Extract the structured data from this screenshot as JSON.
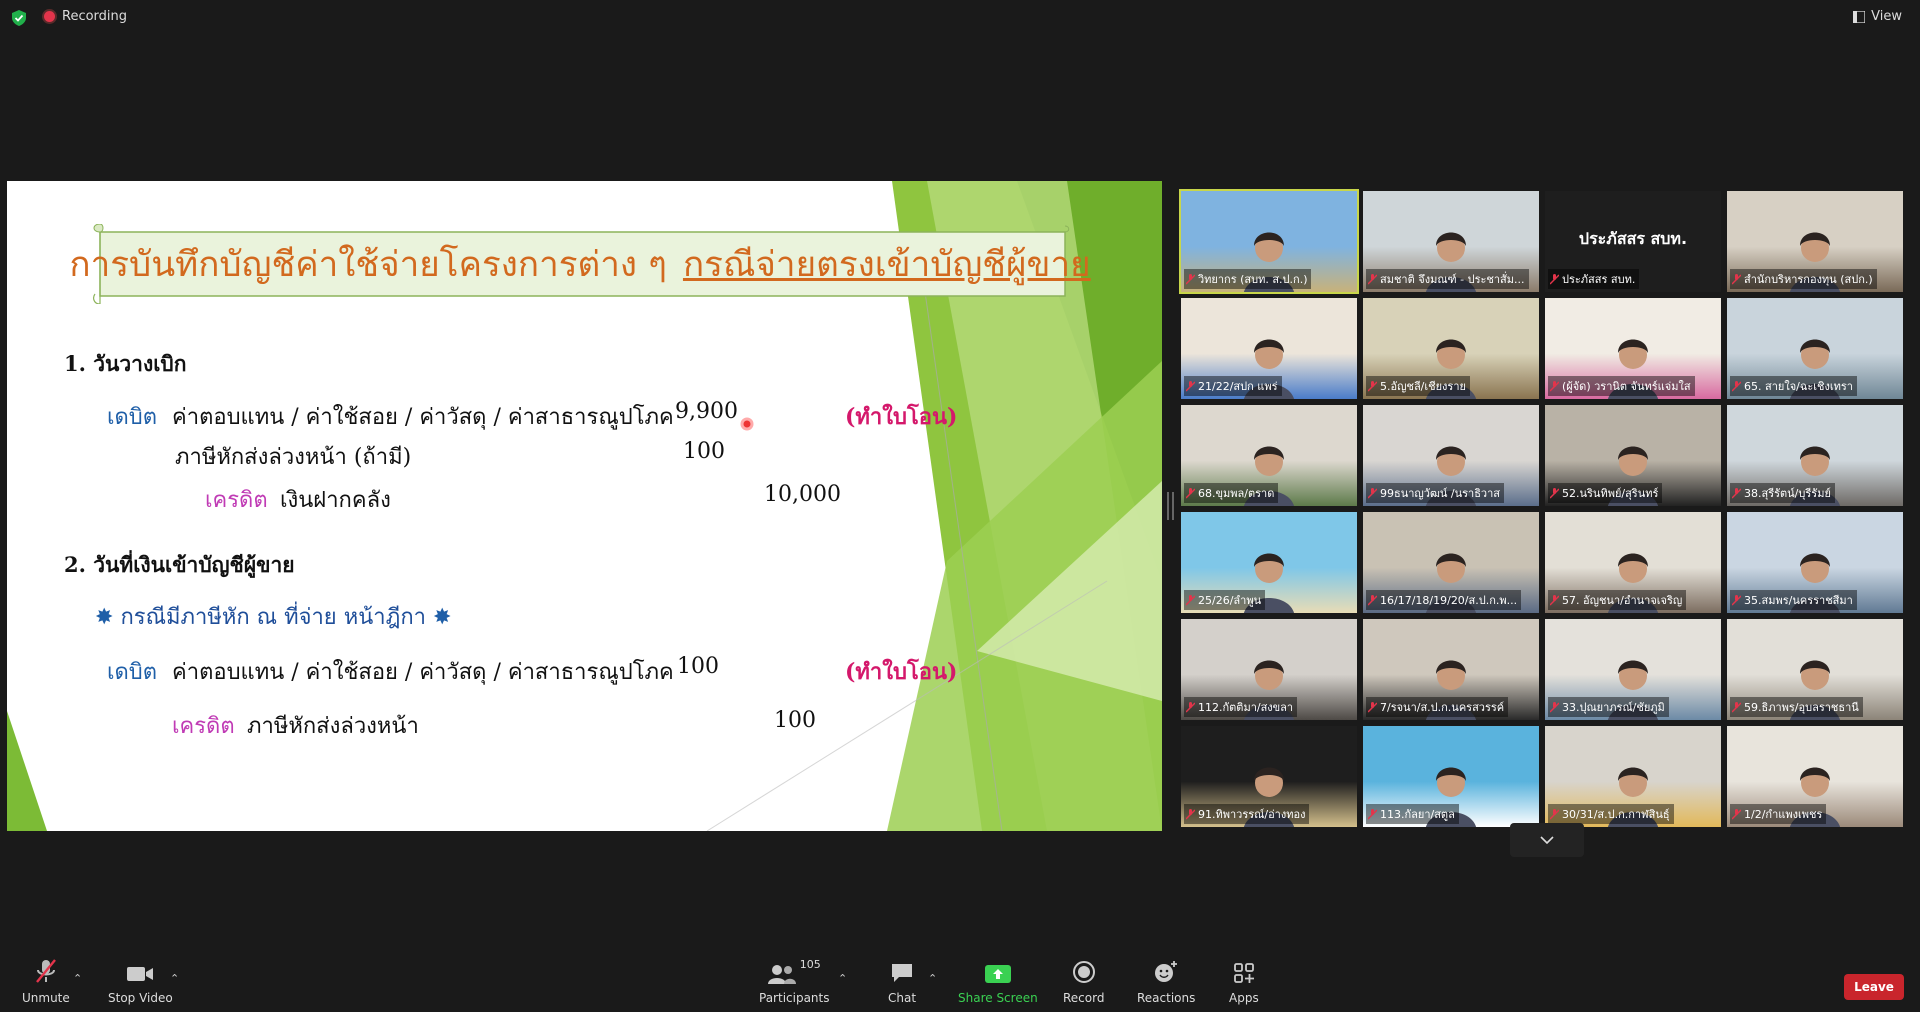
{
  "top": {
    "recording": "Recording",
    "view": "View"
  },
  "slide": {
    "title_part1": "การบันทึกบัญชีค่าใช้จ่ายโครงการต่าง ๆ",
    "title_part2": "กรณีจ่ายตรงเข้าบัญชีผู้ขาย",
    "s1_heading": "1. วันวางเบิก",
    "s1_debit_label": "เดบิต",
    "s1_debit_item": "ค่าตอบแทน / ค่าใช้สอย / ค่าวัสดุ / ค่าสาธารณูปโภค",
    "s1_debit_amount": "9,900",
    "s1_note": "(ทำใบโอน)",
    "s1_tax_item": "ภาษีหักส่งล่วงหน้า (ถ้ามี)",
    "s1_tax_amount": "100",
    "s1_credit_label": "เครดิต",
    "s1_credit_item": "เงินฝากคลัง",
    "s1_credit_amount": "10,000",
    "s2_heading": "2. วันที่เงินเข้าบัญชีผู้ขาย",
    "s2_subcase": "กรณีมีภาษีหัก ณ ที่จ่าย หน้าฎีกา",
    "s2_debit_label": "เดบิต",
    "s2_debit_item": "ค่าตอบแทน / ค่าใช้สอย / ค่าวัสดุ / ค่าสาธารณูปโภค",
    "s2_debit_amount": "100",
    "s2_note": "(ทำใบโอน)",
    "s2_credit_label": "เครดิต",
    "s2_credit_item": "ภาษีหักส่งล่วงหน้า",
    "s2_credit_amount": "100"
  },
  "participants": [
    {
      "name": "วิทยากร (สบท. ส.ป.ก.)",
      "scene": "temple"
    },
    {
      "name": "สมชาติ จึงมณฑ์ - ประชาสั่ม...",
      "scene": "office"
    },
    {
      "name": "ประภัสสร สบท.",
      "big": "ประภัสสร สบท.",
      "scene": "black"
    },
    {
      "name": "สำนักบริหารกองทุน (สปก.)",
      "scene": "office2"
    },
    {
      "name": "21/22/สปก แพร่",
      "scene": "room"
    },
    {
      "name": "5.อัญชลี/เชียงราย",
      "scene": "office3"
    },
    {
      "name": "(ผู้จัด) วรานิต จันทร์แจ่มใส",
      "scene": "pink"
    },
    {
      "name": "65. สายใจ/ฉะเชิงเทรา",
      "scene": "office4"
    },
    {
      "name": "68.ขุมพล/ตราด",
      "scene": "room2"
    },
    {
      "name": "99ธนาญวัฒน์ /นราธิวาส",
      "scene": "man"
    },
    {
      "name": "52.นรินทิพย์/สุรินทร์",
      "scene": "shelf"
    },
    {
      "name": "38.สุรีรัตน์/บุรีรัมย์",
      "scene": "office5"
    },
    {
      "name": "25/26/ลำพูน",
      "scene": "beach"
    },
    {
      "name": "16/17/18/19/20/ส.ป.ก.พ...",
      "scene": "meeting"
    },
    {
      "name": "57. อัญชนา/อำนาจเจริญ",
      "scene": "desk"
    },
    {
      "name": "35.สมพร/นครราชสีมา",
      "scene": "office6"
    },
    {
      "name": "112.กัตติมา/สงขลา",
      "scene": "office7"
    },
    {
      "name": "7/รจนา/ส.ป.ก.นครสวรรค์",
      "scene": "shelf2"
    },
    {
      "name": "33.ปุณยาภรณ์/ชัยภูมิ",
      "scene": "room3"
    },
    {
      "name": "59.ธิภาพร/อุบลราชธานี",
      "scene": "office8"
    },
    {
      "name": "91.ทิพาวรรณ์/อ่างทอง",
      "scene": "dark"
    },
    {
      "name": "113.กัลยา/สตูล",
      "scene": "blue"
    },
    {
      "name": "30/31/ส.ป.ก.กาฬสินธุ์",
      "scene": "office9"
    },
    {
      "name": "1/2/กำแพงเพชร",
      "scene": "desk2"
    }
  ],
  "toolbar": {
    "unmute": "Unmute",
    "stop_video": "Stop Video",
    "participants": "Participants",
    "participant_count": "105",
    "chat": "Chat",
    "share": "Share Screen",
    "record": "Record",
    "reactions": "Reactions",
    "apps": "Apps",
    "leave": "Leave"
  },
  "colors": {
    "accent_green": "#3ad152",
    "leave_red": "#c9252c",
    "active_border": "#c8d64a"
  }
}
